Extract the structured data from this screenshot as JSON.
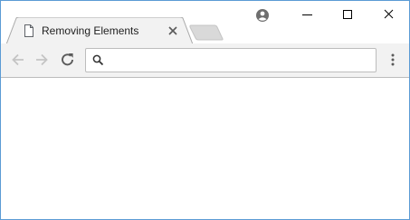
{
  "tab": {
    "title": "Removing Elements",
    "favicon": "page-icon",
    "close_icon": "close-icon"
  },
  "newtab": {
    "icon": "new-tab-icon"
  },
  "window_controls": {
    "profile_icon": "profile-icon",
    "minimize_icon": "minimize-icon",
    "maximize_icon": "maximize-icon",
    "close_icon": "close-icon"
  },
  "toolbar": {
    "back_icon": "arrow-left-icon",
    "forward_icon": "arrow-right-icon",
    "reload_icon": "reload-icon",
    "menu_icon": "more-vertical-icon"
  },
  "omnibox": {
    "icon": "search-icon",
    "value": "",
    "placeholder": ""
  },
  "colors": {
    "window_border": "#5b9bd5",
    "toolbar_bg": "#f2f2f2",
    "tab_bg": "#f2f2f2",
    "inactive_tab": "#d9d9d9"
  }
}
